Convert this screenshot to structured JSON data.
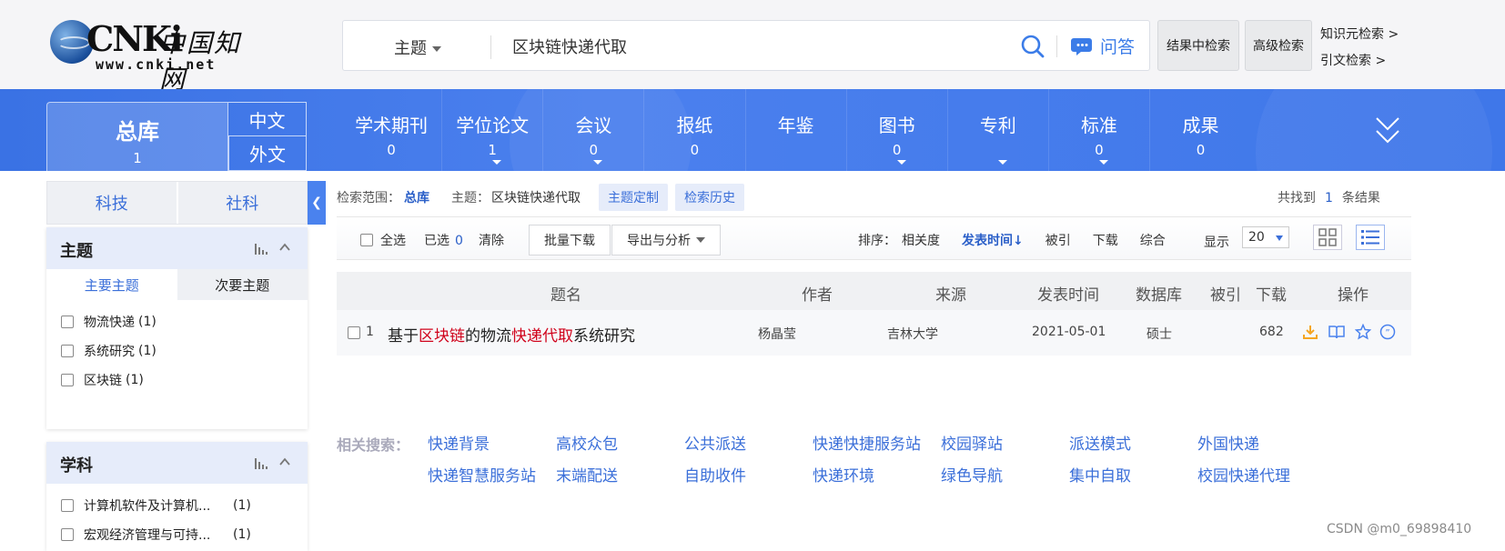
{
  "logo": {
    "brand": "CNKi",
    "cn_name": "中国知网",
    "url": "www.cnki.net"
  },
  "search": {
    "field": "主题",
    "query": "区块链快递代取",
    "qa_label": "问答"
  },
  "header_buttons": {
    "within_results": "结果中检索",
    "advanced": "高级检索"
  },
  "header_links": {
    "knowledge": "知识元检索 >",
    "citation": "引文检索 >"
  },
  "nav": {
    "total_label": "总库",
    "total_count": "1",
    "lang_zh": "中文",
    "lang_foreign": "外文",
    "items": [
      {
        "label": "学术期刊",
        "count": "0",
        "dropdown": false
      },
      {
        "label": "学位论文",
        "count": "1",
        "dropdown": true
      },
      {
        "label": "会议",
        "count": "0",
        "dropdown": true
      },
      {
        "label": "报纸",
        "count": "0",
        "dropdown": false
      },
      {
        "label": "年鉴",
        "count": "",
        "dropdown": false
      },
      {
        "label": "图书",
        "count": "0",
        "dropdown": true
      },
      {
        "label": "专利",
        "count": "",
        "dropdown": true
      },
      {
        "label": "标准",
        "count": "0",
        "dropdown": true
      },
      {
        "label": "成果",
        "count": "0",
        "dropdown": false
      }
    ]
  },
  "sidebar": {
    "cat_tabs": [
      "科技",
      "社科"
    ],
    "topic_panel": {
      "title": "主题",
      "subtabs": [
        "主要主题",
        "次要主题"
      ],
      "facets": [
        {
          "name": "物流快递",
          "count": "(1)"
        },
        {
          "name": "系统研究",
          "count": "(1)"
        },
        {
          "name": "区块链",
          "count": "(1)"
        }
      ]
    },
    "subject_panel": {
      "title": "学科",
      "facets": [
        {
          "name": "计算机软件及计算机...",
          "count": "(1)"
        },
        {
          "name": "宏观经济管理与可持...",
          "count": "(1)"
        }
      ]
    }
  },
  "scope": {
    "label": "检索范围：",
    "scope_value": "总库",
    "query_label": "主题：",
    "query_value": "区块链快递代取",
    "btn_customize": "主题定制",
    "btn_history": "检索历史"
  },
  "result_count": {
    "prefix": "共找到",
    "count": "1",
    "suffix": "条结果"
  },
  "toolbar": {
    "select_all": "全选",
    "selected_label": "已选",
    "selected_count": "0",
    "clear": "清除",
    "batch_download": "批量下载",
    "export": "导出与分析",
    "sort_label": "排序：",
    "sort_options": [
      "相关度",
      "发表时间↓",
      "被引",
      "下载",
      "综合"
    ],
    "sort_active": "发表时间↓",
    "show_label": "显示",
    "page_size": "20"
  },
  "table": {
    "headers": [
      "题名",
      "作者",
      "来源",
      "发表时间",
      "数据库",
      "被引",
      "下载",
      "操作"
    ],
    "rows": [
      {
        "index": "1",
        "title_parts": [
          {
            "text": "基于",
            "hl": false
          },
          {
            "text": "区块链",
            "hl": true
          },
          {
            "text": "的物流",
            "hl": false
          },
          {
            "text": "快递代取",
            "hl": true
          },
          {
            "text": "系统研究",
            "hl": false
          }
        ],
        "author": "杨晶莹",
        "source": "吉林大学",
        "date": "2021-05-01",
        "database": "硕士",
        "cited": "",
        "downloads": "682"
      }
    ]
  },
  "related": {
    "label": "相关搜索：",
    "links": [
      "快递背景",
      "高校众包",
      "公共派送",
      "快递快捷服务站",
      "校园驿站",
      "派送模式",
      "外国快递",
      "快递智慧服务站",
      "末端配送",
      "自助收件",
      "快递环境",
      "绿色导航",
      "集中自取",
      "校园快递代理"
    ]
  },
  "watermark": "CSDN @m0_69898410",
  "colors": {
    "nav_blue": "#3f77e9",
    "link_blue": "#3b6fd9",
    "highlight_red": "#d0021b",
    "download_orange": "#f5a623"
  }
}
